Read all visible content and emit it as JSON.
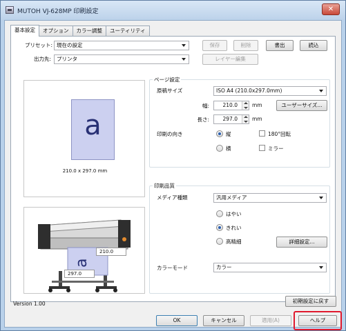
{
  "window": {
    "title": "MUTOH VJ-628MP 印刷設定",
    "close_glyph": "✕"
  },
  "tabs": [
    "基本設定",
    "オプション",
    "カラー調整",
    "ユーティリティ"
  ],
  "preset": {
    "label": "プリセット:",
    "value": "現在の設定",
    "save": "保存",
    "delete": "削除",
    "export": "書出",
    "import": "読込"
  },
  "output": {
    "label": "出力先:",
    "value": "プリンタ",
    "layer_edit": "レイヤー編集"
  },
  "preview": {
    "page_letter": "a",
    "page_size_text": "210.0 x 297.0 mm",
    "printer_width": "210.0",
    "printer_length": "297.0"
  },
  "page_settings": {
    "title": "ページ設定",
    "paper_size_label": "原稿サイズ",
    "paper_size_value": "ISO A4 (210.0x297.0mm)",
    "width_label": "幅:",
    "width_value": "210.0",
    "length_label": "長さ:",
    "length_value": "297.0",
    "unit": "mm",
    "user_size_button": "ユーザーサイズ...",
    "orientation_label": "印刷の向き",
    "portrait": "縦",
    "landscape": "横",
    "rotate180": "180°回転",
    "mirror": "ミラー",
    "orientation_selected": "portrait"
  },
  "print_quality": {
    "title": "印刷品質",
    "media_label": "メディア種類",
    "media_value": "汎用メディア",
    "quality_fast": "はやい",
    "quality_fine": "きれい",
    "quality_high": "高精細",
    "quality_selected": "fine",
    "detail_button": "詳細設定..."
  },
  "color_mode": {
    "label": "カラーモード",
    "value": "カラー"
  },
  "footer": {
    "version": "Version 1.00",
    "reset": "初期設定に戻す",
    "ok": "OK",
    "cancel": "キャンセル",
    "apply": "適用(A)",
    "help": "ヘルプ"
  },
  "colors": {
    "highlight": "#e0182d",
    "page_fill": "#ccd0f0",
    "selected_radio": "#2a5fb0"
  }
}
